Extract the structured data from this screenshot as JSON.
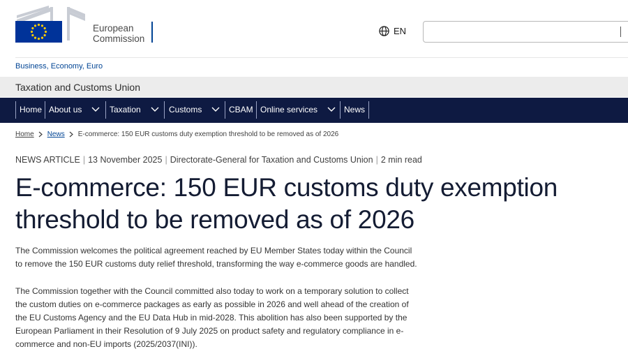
{
  "header": {
    "logo_line1": "European",
    "logo_line2": "Commission",
    "language": "EN",
    "search_placeholder": ""
  },
  "site": {
    "parent_link": "Business, Economy, Euro",
    "title": "Taxation and Customs Union"
  },
  "nav": {
    "items": [
      {
        "label": "Home",
        "dropdown": false
      },
      {
        "label": "About us",
        "dropdown": true
      },
      {
        "label": "Taxation",
        "dropdown": true
      },
      {
        "label": "Customs",
        "dropdown": true
      },
      {
        "label": "CBAM",
        "dropdown": false
      },
      {
        "label": "Online services",
        "dropdown": true
      },
      {
        "label": "News",
        "dropdown": false
      }
    ]
  },
  "breadcrumb": {
    "home": "Home",
    "news": "News",
    "current": "E-commerce: 150 EUR customs duty exemption threshold to be removed as of 2026"
  },
  "article": {
    "type": "NEWS ARTICLE",
    "date": "13 November 2025",
    "author": "Directorate-General for Taxation and Customs Union",
    "read_time": "2 min read",
    "title_line1": "E-commerce: 150 EUR customs duty exemption",
    "title_line2": "threshold to be removed as of 2026",
    "para1_line1": "The Commission welcomes the political agreement reached by EU Member States today within the Council",
    "para1_line2": "to remove the 150 EUR customs duty relief threshold, transforming the way e-commerce goods are handled.",
    "para2_line1": "The Commission together with the Council committed also today to work on a temporary solution to collect",
    "para2_line2": "the custom duties on e-commerce packages as early as possible in 2026 and well ahead of the creation of",
    "para2_line3": "the EU Customs Agency and the EU Data Hub in mid-2028. This abolition has also been supported by the",
    "para2_line4": "European Parliament in their Resolution of 9 July 2025 on product safety and regulatory compliance in e-",
    "para2_line5": "commerce and non-EU imports (2025/2037(INI))."
  },
  "colors": {
    "nav_bg": "#0e1a42",
    "link": "#004494",
    "flag_blue": "#003399",
    "flag_star": "#ffcc00"
  }
}
